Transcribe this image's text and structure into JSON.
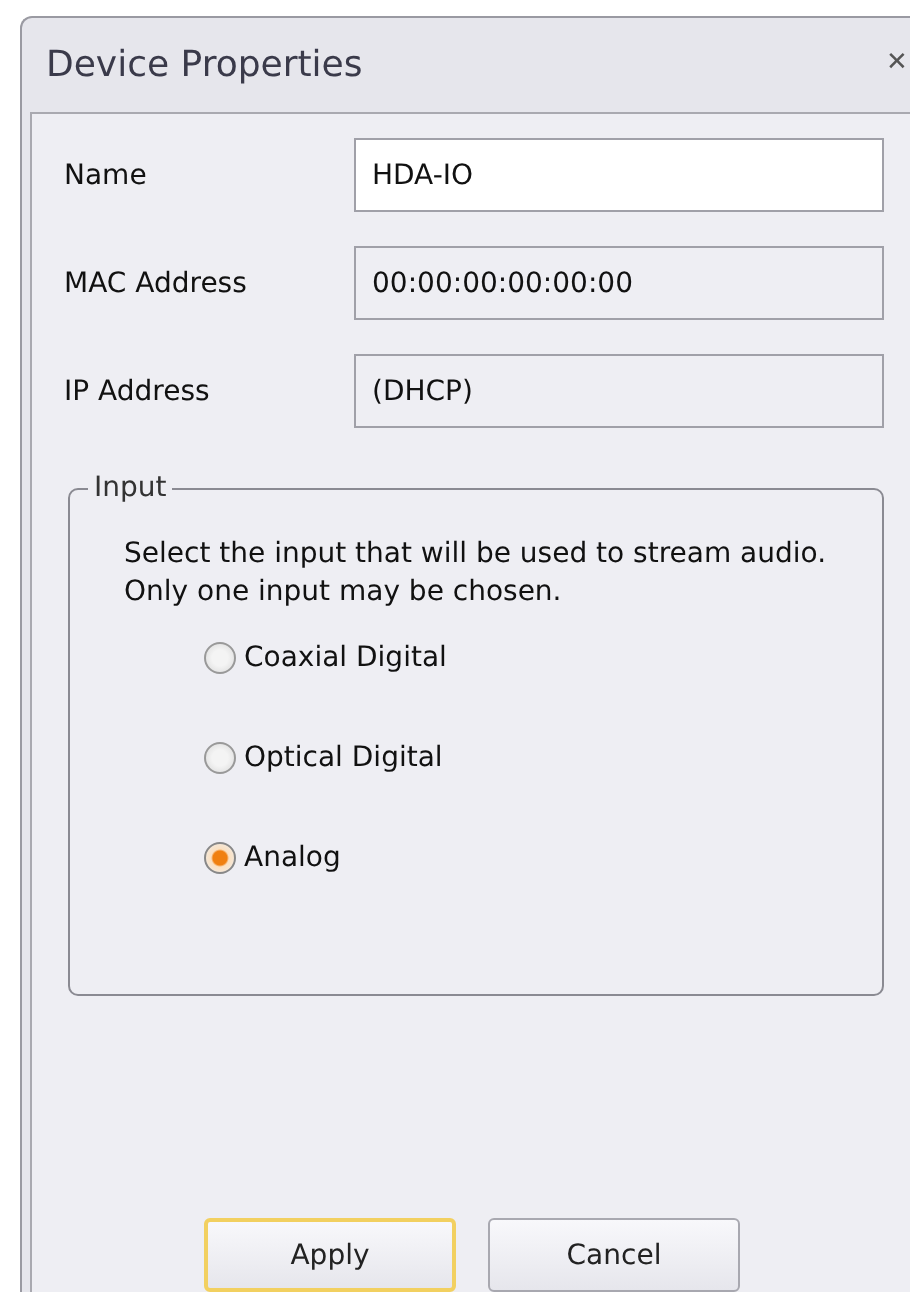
{
  "window": {
    "title": "Device Properties",
    "close": "✕"
  },
  "fields": [
    {
      "label": "Name",
      "value": "HDA-IO",
      "readonly": false
    },
    {
      "label": "MAC Address",
      "value": "00:00:00:00:00:00",
      "readonly": true
    },
    {
      "label": "IP Address",
      "value": "(DHCP)",
      "readonly": true
    }
  ],
  "input_group": {
    "title": "Input",
    "description": "Select the input that will be used to stream audio. Only one input may be chosen.",
    "options": [
      {
        "label": "Coaxial Digital",
        "selected": false
      },
      {
        "label": "Optical Digital",
        "selected": false
      },
      {
        "label": "Analog",
        "selected": true
      }
    ]
  },
  "buttons": [
    {
      "label": "Apply",
      "focused": true
    },
    {
      "label": "Cancel",
      "focused": false
    }
  ]
}
